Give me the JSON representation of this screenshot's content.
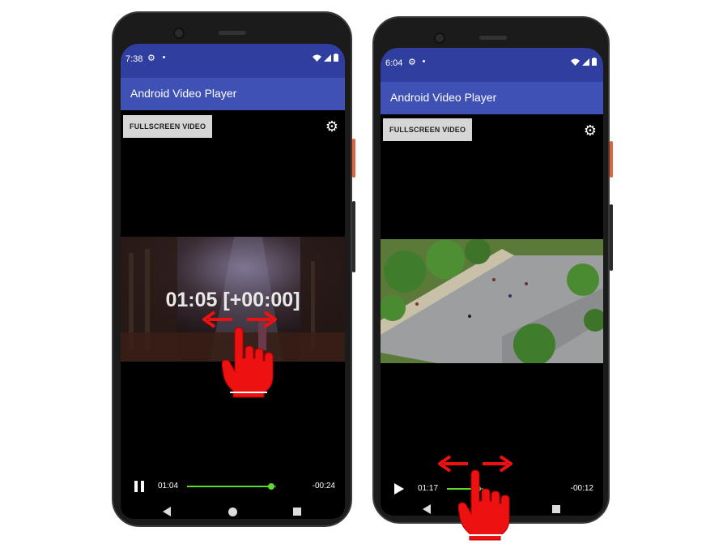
{
  "left_phone": {
    "status": {
      "time": "7:38"
    },
    "app_title": "Android Video Player",
    "fullscreen_button": "FULLSCREEN VIDEO",
    "seek_overlay": "01:05 [+00:00]",
    "controls": {
      "elapsed": "01:04",
      "remaining": "-00:24",
      "progress": 0.92,
      "state": "playing"
    }
  },
  "right_phone": {
    "status": {
      "time": "6:04"
    },
    "app_title": "Android Video Player",
    "fullscreen_button": "FULLSCREEN VIDEO",
    "controls": {
      "elapsed": "01:17",
      "remaining": "-00:12",
      "progress": 0.85,
      "state": "paused"
    }
  },
  "colors": {
    "status_bar": "#303f9f",
    "app_bar": "#3f51b5",
    "seek_bar": "#5cdb2e",
    "gesture_hand": "#ee1111"
  },
  "icons": [
    "settings-gear-icon",
    "pause-icon",
    "play-icon",
    "back-nav-icon",
    "home-nav-icon",
    "recents-nav-icon",
    "wifi-icon",
    "signal-icon",
    "battery-icon",
    "swipe-hand-icon",
    "double-arrow-icon"
  ]
}
